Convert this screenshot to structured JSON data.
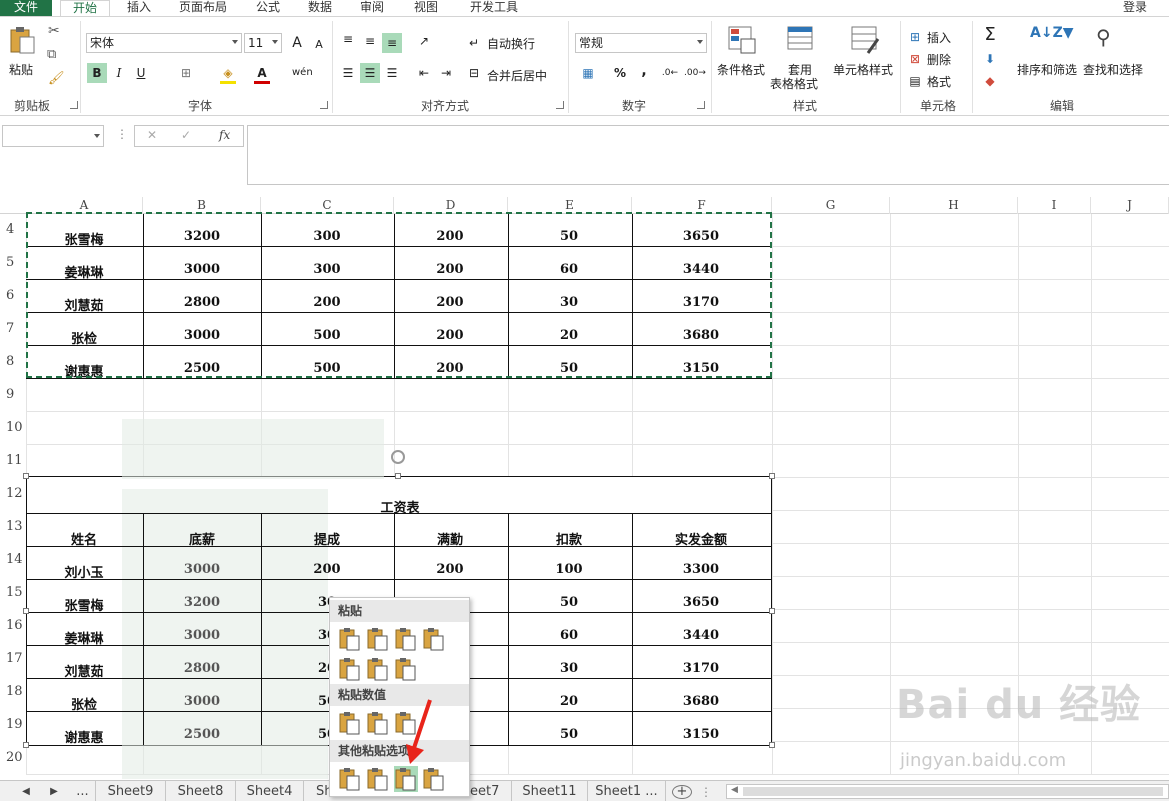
{
  "tabs": [
    "文件",
    "开始",
    "插入",
    "页面布局",
    "公式",
    "数据",
    "审阅",
    "视图",
    "开发工具"
  ],
  "login": "登录",
  "ribbon": {
    "clipboard": {
      "paste": "粘贴",
      "label": "剪贴板"
    },
    "font": {
      "name": "宋体",
      "size": "11",
      "bold": "B",
      "italic": "I",
      "underline": "U",
      "grow": "A",
      "shrink": "A",
      "label": "字体"
    },
    "align": {
      "wrap": "自动换行",
      "merge": "合并后居中",
      "label": "对齐方式"
    },
    "number": {
      "format": "常规",
      "percent": "%",
      "comma": ",",
      "label": "数字"
    },
    "styles": {
      "cond": "条件格式",
      "table_line1": "套用",
      "table_line2": "表格格式",
      "cell_style": "单元格样式",
      "label": "样式"
    },
    "cells": {
      "insert": "插入",
      "delete": "删除",
      "format": "格式",
      "label": "单元格"
    },
    "editing": {
      "sort": "排序和筛选",
      "find": "查找和选择",
      "label": "编辑"
    }
  },
  "formula": {
    "namebox": "",
    "fx": "fx",
    "cancel": "✕",
    "enter": "✓"
  },
  "columns": [
    "A",
    "B",
    "C",
    "D",
    "E",
    "F",
    "G",
    "H",
    "I",
    "J"
  ],
  "rows": [
    "4",
    "5",
    "6",
    "7",
    "8",
    "9",
    "10",
    "11",
    "12",
    "13",
    "14",
    "15",
    "16",
    "17",
    "18",
    "19",
    "20"
  ],
  "table_top": [
    [
      "张雪梅",
      "3200",
      "300",
      "200",
      "50",
      "3650"
    ],
    [
      "姜琳琳",
      "3000",
      "300",
      "200",
      "60",
      "3440"
    ],
    [
      "刘慧茹",
      "2800",
      "200",
      "200",
      "30",
      "3170"
    ],
    [
      "张检",
      "3000",
      "500",
      "200",
      "20",
      "3680"
    ],
    [
      "谢惠惠",
      "2500",
      "500",
      "200",
      "50",
      "3150"
    ]
  ],
  "picture": {
    "title": "工资表",
    "headers": [
      "姓名",
      "底薪",
      "提成",
      "满勤",
      "扣款",
      "实发金额"
    ],
    "rows": [
      [
        "刘小玉",
        "3000",
        "200",
        "200",
        "100",
        "3300"
      ],
      [
        "张雪梅",
        "3200",
        "30",
        "",
        "50",
        "3650"
      ],
      [
        "姜琳琳",
        "3000",
        "30",
        "",
        "60",
        "3440"
      ],
      [
        "刘慧茹",
        "2800",
        "20",
        "",
        "30",
        "3170"
      ],
      [
        "张检",
        "3000",
        "50",
        "",
        "20",
        "3680"
      ],
      [
        "谢惠惠",
        "2500",
        "50",
        "",
        "50",
        "3150"
      ]
    ]
  },
  "paste_menu": {
    "paste": "粘贴",
    "paste_values": "粘贴数值",
    "other": "其他粘贴选项"
  },
  "sheet_tabs": [
    "...",
    "Sheet9",
    "Sheet8",
    "Sheet4",
    "Sh",
    "eet7",
    "Sheet11",
    "Sheet1 ..."
  ],
  "watermark": {
    "brand": "Bai du 经验",
    "url": "jingyan.baidu.com"
  },
  "colors": {
    "accent": "#217346",
    "selection": "#a9dab9",
    "marching_ants": "#217346"
  }
}
